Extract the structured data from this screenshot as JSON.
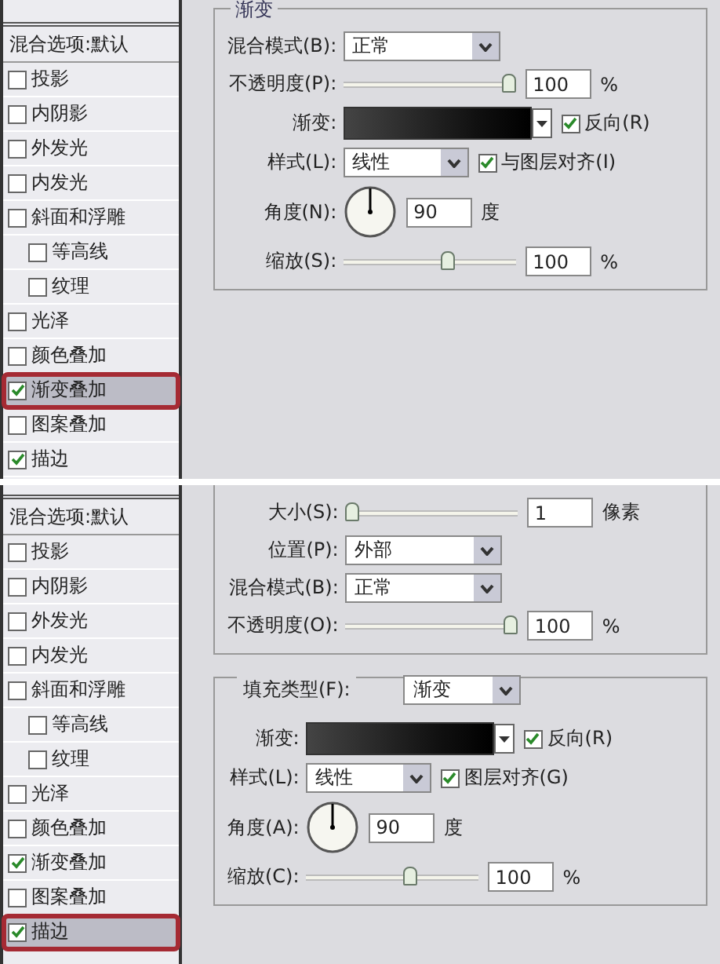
{
  "panels": [
    {
      "sidebar": {
        "header": "混合选项:默认",
        "items": [
          {
            "label": "投影",
            "checked": false,
            "selected": false
          },
          {
            "label": "内阴影",
            "checked": false,
            "selected": false
          },
          {
            "label": "外发光",
            "checked": false,
            "selected": false
          },
          {
            "label": "内发光",
            "checked": false,
            "selected": false
          },
          {
            "label": "斜面和浮雕",
            "checked": false,
            "selected": false,
            "children": [
              {
                "label": "等高线",
                "checked": false,
                "selected": false
              },
              {
                "label": "纹理",
                "checked": false,
                "selected": false
              }
            ]
          },
          {
            "label": "光泽",
            "checked": false,
            "selected": false
          },
          {
            "label": "颜色叠加",
            "checked": false,
            "selected": false
          },
          {
            "label": "渐变叠加",
            "checked": true,
            "selected": true
          },
          {
            "label": "图案叠加",
            "checked": false,
            "selected": false
          },
          {
            "label": "描边",
            "checked": true,
            "selected": false
          }
        ]
      },
      "groups": [
        {
          "title": "渐变",
          "rows": [
            {
              "kind": "select",
              "label": "混合模式(B):",
              "value": "正常"
            },
            {
              "kind": "slider",
              "label": "不透明度(P):",
              "level": 1,
              "value": "100",
              "unit": "%"
            },
            {
              "kind": "gradient",
              "label": "渐变:",
              "checkbox": {
                "label": "反向(R)",
                "checked": true
              }
            },
            {
              "kind": "select",
              "label": "样式(L):",
              "value": "线性",
              "checkbox": {
                "label": "与图层对齐(I)",
                "checked": true
              }
            },
            {
              "kind": "angle",
              "label": "角度(N):",
              "value": "90",
              "unit": "度"
            },
            {
              "kind": "slider",
              "label": "缩放(S):",
              "level": 0.62,
              "value": "100",
              "unit": "%"
            }
          ]
        }
      ]
    },
    {
      "sidebar": {
        "header": "混合选项:默认",
        "items": [
          {
            "label": "投影",
            "checked": false,
            "selected": false
          },
          {
            "label": "内阴影",
            "checked": false,
            "selected": false
          },
          {
            "label": "外发光",
            "checked": false,
            "selected": false
          },
          {
            "label": "内发光",
            "checked": false,
            "selected": false
          },
          {
            "label": "斜面和浮雕",
            "checked": false,
            "selected": false,
            "children": [
              {
                "label": "等高线",
                "checked": false,
                "selected": false
              },
              {
                "label": "纹理",
                "checked": false,
                "selected": false
              }
            ]
          },
          {
            "label": "光泽",
            "checked": false,
            "selected": false
          },
          {
            "label": "颜色叠加",
            "checked": false,
            "selected": false
          },
          {
            "label": "渐变叠加",
            "checked": true,
            "selected": false
          },
          {
            "label": "图案叠加",
            "checked": false,
            "selected": false
          },
          {
            "label": "描边",
            "checked": true,
            "selected": true
          }
        ]
      },
      "groups": [
        {
          "rows": [
            {
              "kind": "slider",
              "label": "大小(S):",
              "level": 0,
              "value": "1",
              "unit": "像素"
            },
            {
              "kind": "select",
              "label": "位置(P):",
              "value": "外部"
            },
            {
              "kind": "select",
              "label": "混合模式(B):",
              "value": "正常"
            },
            {
              "kind": "slider",
              "label": "不透明度(O):",
              "level": 1,
              "value": "100",
              "unit": "%"
            }
          ]
        },
        {
          "header": {
            "label": "填充类型(F):",
            "value": "渐变"
          },
          "rows": [
            {
              "kind": "gradient",
              "label": "渐变:",
              "checkbox": {
                "label": "反向(R)",
                "checked": true
              }
            },
            {
              "kind": "select",
              "label": "样式(L):",
              "value": "线性",
              "checkbox": {
                "label": "图层对齐(G)",
                "checked": true
              }
            },
            {
              "kind": "angle",
              "label": "角度(A):",
              "value": "90",
              "unit": "度"
            },
            {
              "kind": "slider",
              "label": "缩放(C):",
              "level": 0.62,
              "value": "100",
              "unit": "%"
            }
          ]
        }
      ]
    }
  ]
}
